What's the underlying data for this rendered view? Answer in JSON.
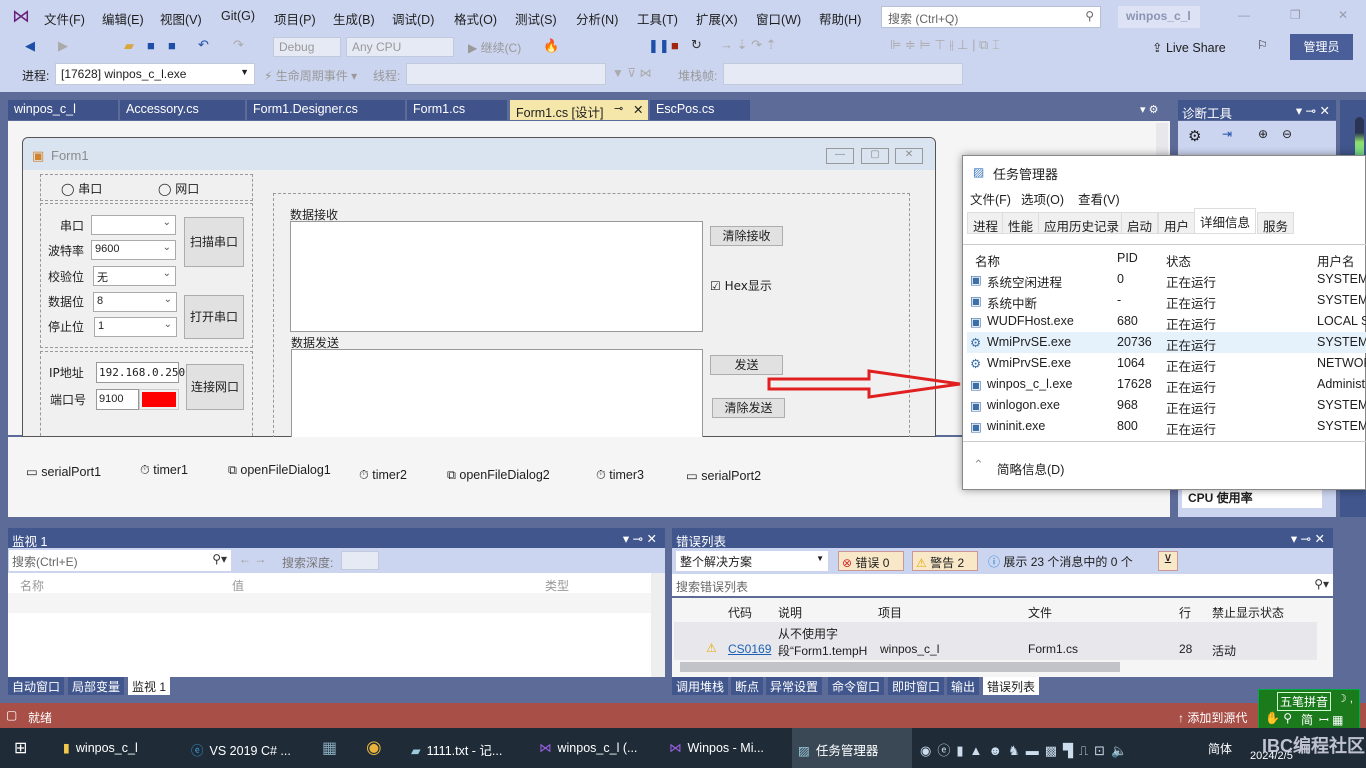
{
  "menu": {
    "items": [
      "文件(F)",
      "编辑(E)",
      "视图(V)",
      "Git(G)",
      "项目(P)",
      "生成(B)",
      "调试(D)",
      "格式(O)",
      "测试(S)",
      "分析(N)",
      "工具(T)",
      "扩展(X)",
      "窗口(W)",
      "帮助(H)"
    ],
    "search_placeholder": "搜索 (Ctrl+Q)",
    "solution_name": "winpos_c_l"
  },
  "toolbar": {
    "config": "Debug",
    "platform": "Any CPU",
    "continue": "继续(C)",
    "live_share": "Live Share",
    "admin": "管理员",
    "process_label": "进程:",
    "process_value": "[17628] winpos_c_l.exe",
    "lifecycle": "生命周期事件",
    "thread_label": "线程:",
    "stack_label": "堆栈帧:"
  },
  "doc_tabs": [
    "winpos_c_l",
    "Accessory.cs",
    "Form1.Designer.cs",
    "Form1.cs",
    "Form1.cs [设计]",
    "EscPos.cs"
  ],
  "form": {
    "title": "Form1",
    "radio_serial": "串口",
    "radio_net": "网口",
    "port_label": "串口",
    "port_value": "",
    "baud_label": "波特率",
    "baud_value": "9600",
    "parity_label": "校验位",
    "parity_value": "无",
    "databits_label": "数据位",
    "databits_value": "8",
    "stopbits_label": "停止位",
    "stopbits_value": "1",
    "scan_btn": "扫描串口",
    "open_btn": "打开串口",
    "ip_label": "IP地址",
    "ip_value": "192.168.0.250",
    "port_no_label": "端口号",
    "port_no_value": "9100",
    "connect_btn": "连接网口",
    "recv_label": "数据接收",
    "send_label": "数据发送",
    "clear_recv": "清除接收",
    "hex_label": "Hex显示",
    "send_btn": "发送",
    "clear_send": "清除发送",
    "status_color": "#ff0000"
  },
  "tray": [
    "serialPort1",
    "timer1",
    "openFileDialog1",
    "timer2",
    "openFileDialog2",
    "timer3",
    "serialPort2"
  ],
  "diag": {
    "title": "诊断工具",
    "cpu": "CPU 使用率"
  },
  "taskmgr": {
    "title": "任务管理器",
    "menu": [
      "文件(F)",
      "选项(O)",
      "查看(V)"
    ],
    "tabs": [
      "进程",
      "性能",
      "应用历史记录",
      "启动",
      "用户",
      "详细信息",
      "服务"
    ],
    "active_tab": "详细信息",
    "columns": [
      "名称",
      "PID",
      "状态",
      "用户名"
    ],
    "rows": [
      [
        "系统空闲进程",
        "0",
        "正在运行",
        "SYSTEM"
      ],
      [
        "系统中断",
        "-",
        "正在运行",
        "SYSTEM"
      ],
      [
        "WUDFHost.exe",
        "680",
        "正在运行",
        "LOCAL S"
      ],
      [
        "WmiPrvSE.exe",
        "20736",
        "正在运行",
        "SYSTEM"
      ],
      [
        "WmiPrvSE.exe",
        "1064",
        "正在运行",
        "NETWOR"
      ],
      [
        "winpos_c_l.exe",
        "17628",
        "正在运行",
        "Administ"
      ],
      [
        "winlogon.exe",
        "968",
        "正在运行",
        "SYSTEM"
      ],
      [
        "wininit.exe",
        "800",
        "正在运行",
        "SYSTEM"
      ]
    ],
    "less_info": "简略信息(D)"
  },
  "watch": {
    "title": "监视 1",
    "search_placeholder": "搜索(Ctrl+E)",
    "depth_label": "搜索深度:",
    "columns": [
      "名称",
      "值",
      "类型"
    ],
    "tabs": [
      "自动窗口",
      "局部变量",
      "监视 1"
    ]
  },
  "errors": {
    "title": "错误列表",
    "scope": "整个解决方案",
    "errors": "错误 0",
    "warnings": "警告 2",
    "messages": "展示 23 个消息中的 0 个",
    "search_placeholder": "搜索错误列表",
    "columns": [
      "代码",
      "说明",
      "项目",
      "文件",
      "行",
      "禁止显示状态"
    ],
    "rows": [
      {
        "code": "CS0169",
        "desc_line1": "从不使用字",
        "desc_line2": "段“Form1.tempH",
        "project": "winpos_c_l",
        "file": "Form1.cs",
        "line": "28",
        "state": "活动"
      }
    ],
    "tabs": [
      "调用堆栈",
      "断点",
      "异常设置",
      "命令窗口",
      "即时窗口",
      "输出",
      "错误列表"
    ]
  },
  "status": {
    "ready": "就绪",
    "source_control": "添加到源代"
  },
  "ime": {
    "name": "五笔拼音",
    "mode": "简"
  },
  "taskbar": {
    "items": [
      "winpos_c_l",
      "VS 2019 C# ...",
      "1111.txt - 记...",
      "winpos_c_l (...",
      "Winpos - Mi...",
      "任务管理器"
    ],
    "lang": "简体",
    "date": "2024/2/5"
  }
}
